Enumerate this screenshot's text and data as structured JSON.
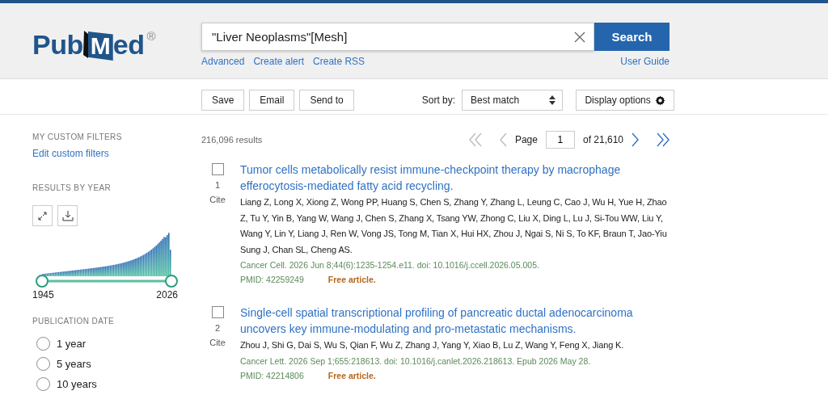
{
  "logo": {
    "before": "Pub",
    "mark": "M",
    "after": "ed",
    "registered": "®"
  },
  "search": {
    "value": "\"Liver Neoplasms\"[Mesh]",
    "button": "Search"
  },
  "search_links": [
    "Advanced",
    "Create alert",
    "Create RSS"
  ],
  "user_guide": "User Guide",
  "actions": [
    "Save",
    "Email",
    "Send to"
  ],
  "sort": {
    "label": "Sort by:",
    "value": "Best match"
  },
  "display_options": "Display options",
  "sidebar": {
    "custom_filters_heading": "MY CUSTOM FILTERS",
    "edit_filters": "Edit custom filters",
    "results_by_year_heading": "RESULTS BY YEAR",
    "year_start": "1945",
    "year_end": "2026",
    "year_handles": [
      {
        "level": 0
      },
      {
        "level": 1
      }
    ],
    "publication_date_heading": "PUBLICATION DATE",
    "date_options": [
      {
        "label": "1 year",
        "selected": false
      },
      {
        "label": "5 years",
        "selected": false
      },
      {
        "label": "10 years",
        "selected": false
      }
    ]
  },
  "results_count": "216,096 results",
  "pagination": {
    "page_label": "Page",
    "page": "1",
    "of": "of 21,610"
  },
  "results": [
    {
      "number": "1",
      "cite": "Cite",
      "selected": false,
      "title": "Tumor cells metabolically resist immune-checkpoint therapy by macrophage efferocytosis-mediated fatty acid recycling.",
      "authors": "Liang Z, Long X, Xiong Z, Wong PP, Huang S, Chen S, Zhang Y, Zhang L, Leung C, Cao J, Wu H, Yue H, Zhao Z, Tu Y, Yin B, Yang W, Wang J, Chen S, Zhang X, Tsang YW, Zhong C, Liu X, Ding L, Lu J, Si-Tou WW, Liu Y, Wang Y, Lin Y, Liang J, Ren W, Vong JS, Tong M, Tian X, Hui HX, Zhou J, Ngai S, Ni S, To KF, Braun T, Jao-Yiu Sung J, Chan SL, Cheng AS.",
      "citation": "Cancer Cell. 2026 Jun 8;44(6):1235-1254.e11. doi: 10.1016/j.ccell.2026.05.005.",
      "pmid": "PMID: 42259249",
      "free": "Free article."
    },
    {
      "number": "2",
      "cite": "Cite",
      "selected": false,
      "title": "Single-cell spatial transcriptional profiling of pancreatic ductal adenocarcinoma uncovers key immune-modulating and pro-metastatic mechanisms.",
      "authors": "Zhou J, Shi G, Dai S, Wu S, Qian F, Wu Z, Zhang J, Yang Y, Xiao B, Lu Z, Wang Y, Feng X, Jiang K.",
      "citation": "Cancer Lett. 2026 Sep 1;655:218613. doi: 10.1016/j.canlet.2026.218613. Epub 2026 May 28.",
      "pmid": "PMID: 42214806",
      "free": "Free article."
    }
  ]
}
